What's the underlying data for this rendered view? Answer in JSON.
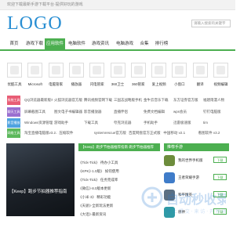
{
  "topbar": {
    "text": "欢迎下载最新手游下载平台·提供好玩的游戏"
  },
  "logo": {
    "text": "LOGO"
  },
  "search": {
    "placeholder": "请输入搜索的关键字"
  },
  "nav": {
    "items": [
      {
        "label": "首页",
        "active": false
      },
      {
        "label": "游戏下载",
        "active": false
      },
      {
        "label": "应用软件",
        "active": true
      },
      {
        "label": "电脑软件",
        "active": false
      },
      {
        "label": "游戏资讯",
        "active": false
      },
      {
        "label": "电脑游戏",
        "active": false
      },
      {
        "label": "合集",
        "active": false
      },
      {
        "label": "排行榜",
        "active": false
      }
    ]
  },
  "software_icons": [
    {
      "label": "优酷工具"
    },
    {
      "label": "Microsoft"
    },
    {
      "label": "电脑管家"
    },
    {
      "label": "播放器"
    },
    {
      "label": "闪电管家"
    },
    {
      "label": "360卫士"
    },
    {
      "label": "360管家"
    },
    {
      "label": "爱上视频"
    },
    {
      "label": "小窗口"
    },
    {
      "label": "翻译"
    },
    {
      "label": "视频编辑"
    }
  ],
  "categories": [
    {
      "badge": "系统工具",
      "color": "#e85d75",
      "links": [
        "QQ浏览器最新版本下载",
        "火狐浏览器官方版",
        "腾讯视频官网下载",
        "三国志战略版手机版下载",
        "金牛云音乐下载",
        "东方证券官方版",
        "福建雨漫人物"
      ]
    },
    {
      "badge": "聊天工具",
      "color": "#9a6fd0",
      "links": [
        "屏幕截图工具",
        "图文电子书编辑器",
        "影音播放器",
        "直播伴侣",
        "免费文档编辑",
        "wps会员",
        "钉钉电脑版"
      ]
    },
    {
      "badge": "影音播放",
      "color": "#4fa3e0",
      "links": [
        "Windows资源管理器",
        "游戏助手",
        "下载工具",
        "夸克浏览器",
        "手机助手",
        "迅雷极速版",
        "tim"
      ]
    },
    {
      "badge": "网络工具",
      "color": "#5cb85c",
      "links": [
        "淘宝直播电脑版v3.2.1",
        "压缩软件",
        "systemrescue官方版 v1.3.6",
        "百度网盘官方正式版 v7.3.4",
        "中国移动 v2.1",
        "看图软件 v3.2"
      ]
    }
  ],
  "banner": {
    "caption": "【Keep】跑步节拍器推荐指南"
  },
  "news": {
    "header": "【Keep】跑步节拍器推荐指南·跑步节拍器推荐",
    "lines": [
      "《Tick-Tick》 待办小工具",
      "《KPK》·1.0版》 如何使用",
      "《Tick-Tick》 任务完成率",
      "《微信》·8.0版本更新",
      "《小米·3》 精彩功能",
      "《天骄》·全新玩法更新",
      "《大话》·最新资讯"
    ]
  },
  "recommend": {
    "header": "推荐手游",
    "button_label": "下载",
    "items": [
      {
        "name": "我的世界手机版",
        "color": "#6d8c3c"
      },
      {
        "name": "王者荣耀手游",
        "color": "#3f7cc9"
      },
      {
        "name": "和平精英",
        "color": "#5b6f82"
      },
      {
        "name": "原神",
        "color": "#2f9aa6"
      }
    ]
  },
  "watermark": {
    "title": "自动秒收录",
    "subtitle": "收 上 提 交 · 来 访 · 开 秒 收 录"
  }
}
